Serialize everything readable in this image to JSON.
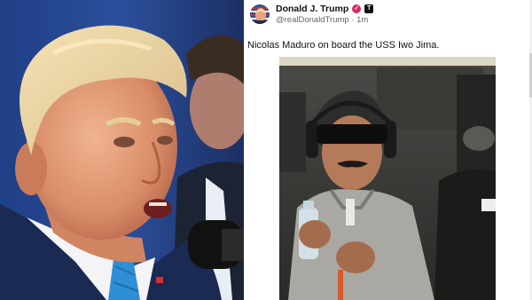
{
  "post": {
    "author_name": "Donald J. Trump",
    "handle": "@realDonaldTrump",
    "separator": "·",
    "time": "1m",
    "text": "Nicolas Maduro on board the USS Iwo Jima.",
    "verified_icon": "verified-badge-icon",
    "platform_icon": "platform-badge-icon"
  },
  "colors": {
    "verified": "#e0245e",
    "text": "#111111",
    "muted": "#666666"
  }
}
